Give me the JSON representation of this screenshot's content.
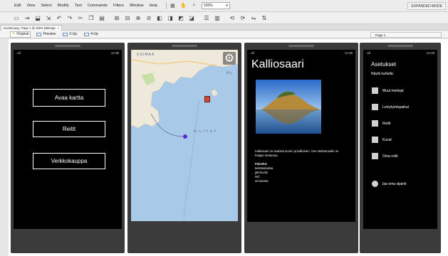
{
  "menu": {
    "items": [
      "Edit",
      "View",
      "Select",
      "Modify",
      "Text",
      "Commands",
      "Filters",
      "Window",
      "Help"
    ],
    "zoom": "100%",
    "mode": "EXPANDED MODE"
  },
  "doc_tab": {
    "title": "scomet.png : Page 1 @ 100% (Bitmap)",
    "close": "×"
  },
  "view_bar": {
    "original": "Original",
    "preview": "Preview",
    "two_up": "2-Up",
    "four_up": "4-Up",
    "page": "Page 1"
  },
  "screens": {
    "home": {
      "signal": ".all",
      "time": "12:38",
      "buttons": [
        "Avaa kartta",
        "Reitit",
        "Verkkokauppa"
      ]
    },
    "map": {
      "signal": ".all",
      "time": "12:38",
      "label_top": "USIMAA",
      "label_gulf": "G u l f   o f",
      "label_mu": "Mu"
    },
    "place": {
      "signal": ".all",
      "time": "12:38",
      "title": "Kalliosaari",
      "description": "Kalliosaari on saarista suurin ja kallioinen. Sen etelärannalle on helppo rantautua.",
      "services_label": "Palvelut:",
      "services": [
        "keittokatoksia",
        "jäteh­uolto",
        "WC",
        "uimaranta"
      ]
    },
    "settings": {
      "signal": ".all",
      "time": "12:38",
      "title": "Asetukset",
      "subtitle": "Näytä kartalla:",
      "options": [
        "Muut meloijat",
        "Leiriytymispaikat",
        "Reitit",
        "Kuvat",
        "Oma reitti"
      ],
      "share": "Jaa oma sijainti"
    }
  }
}
